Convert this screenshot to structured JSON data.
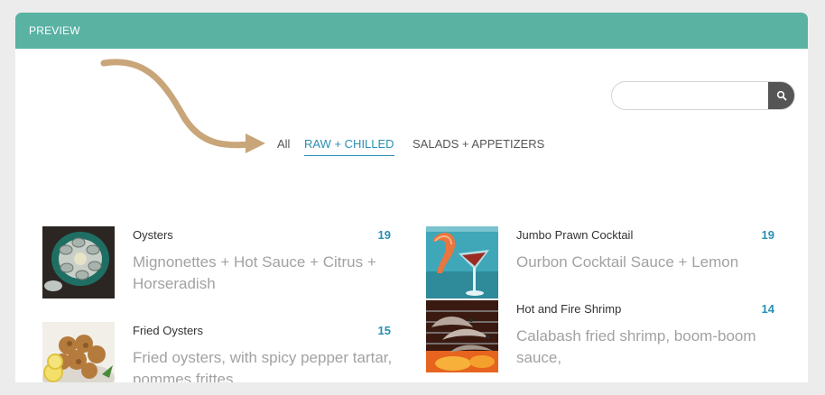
{
  "header": {
    "title": "PREVIEW"
  },
  "search": {
    "placeholder": "",
    "button_icon": "search-icon"
  },
  "tabs": [
    {
      "label": "All",
      "active": false
    },
    {
      "label": "RAW + CHILLED",
      "active": true
    },
    {
      "label": "SALADS + APPETIZERS",
      "active": false
    }
  ],
  "colors": {
    "header": "#5ab2a3",
    "accent": "#2a8fb3",
    "arrow": "#c9a57a"
  },
  "menu": [
    {
      "title": "Oysters",
      "price": "19",
      "desc": "Mignonettes + Hot Sauce + Citrus + Horseradish"
    },
    {
      "title": "Fried Oysters",
      "price": "15",
      "desc": "Fried oysters, with spicy pepper tartar, pommes frittes"
    },
    {
      "title": "Jumbo Prawn Cocktail",
      "price": "19",
      "desc": "Ourbon Cocktail Sauce + Lemon"
    },
    {
      "title": "Hot and Fire Shrimp",
      "price": "14",
      "desc": "Calabash fried shrimp, boom-boom sauce,"
    }
  ]
}
